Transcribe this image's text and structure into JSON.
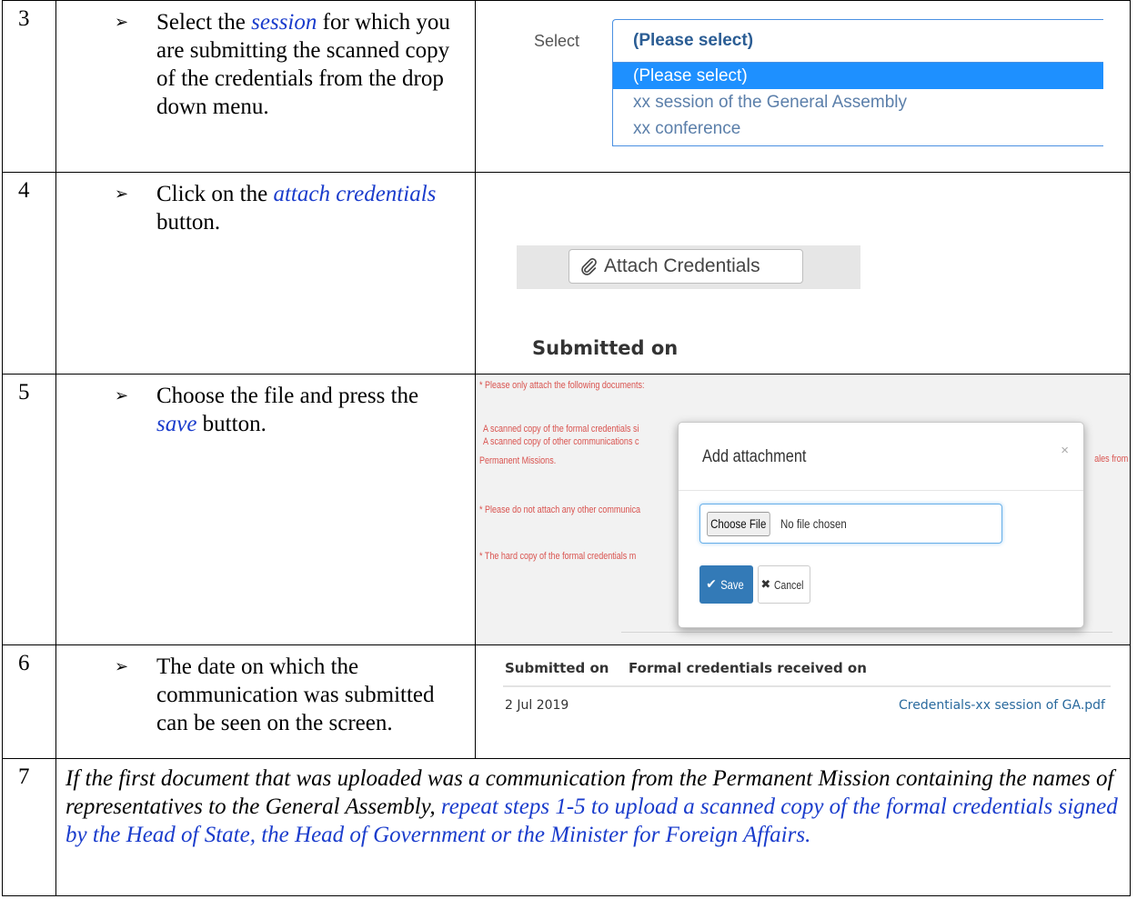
{
  "steps": {
    "step3": {
      "num": "3",
      "text_a": "Select the ",
      "text_em": "session",
      "text_b": " for which you are submitting the scanned copy of the credentials from the drop down menu.",
      "shot": {
        "select_label": "Select",
        "select_value": "(Please select)",
        "options": [
          "(Please select)",
          "xx session of the General Assembly",
          "xx conference"
        ]
      }
    },
    "step4": {
      "num": "4",
      "text_a": "Click on the ",
      "text_em": "attach credentials",
      "text_b": " button.",
      "shot": {
        "button_label": "Attach Credentials",
        "submitted_heading": "Submitted on"
      }
    },
    "step5": {
      "num": "5",
      "text_a": "Choose the file and press the ",
      "text_em": "save",
      "text_b": " button.",
      "shot": {
        "bg_note_1": "* Please only attach the following documents:",
        "bg_note_2": "A scanned copy of the formal credentials si",
        "bg_note_3": "A scanned copy of other communications c",
        "bg_note_4": "Permanent Missions.",
        "bg_note_5": "* Please do not attach any other communica",
        "bg_note_6": "* The hard copy of the formal credentials m",
        "bg_right_fragment": "ales from",
        "modal_title": "Add attachment",
        "modal_close": "×",
        "choose_file": "Choose File",
        "no_file": "No file chosen",
        "save": "Save",
        "cancel": "Cancel"
      }
    },
    "step6": {
      "num": "6",
      "text": "The date on which the communication was submitted can be seen on the screen.",
      "shot": {
        "col_submitted": "Submitted on",
        "col_received": "Formal credentials received on",
        "date": "2 Jul 2019",
        "file_link": "Credentials-xx session of GA.pdf"
      }
    },
    "step7": {
      "num": "7",
      "text_a": "If the first document that was uploaded was a communication from the Permanent Mission containing the names of representatives to the General Assembly, ",
      "text_em": "repeat steps 1-5 to upload a scanned copy of the formal credentials signed by the Head of State, the Head of Government or the Minister for Foreign Affairs."
    }
  },
  "icons": {
    "bullet": "arrow-bullet-icon",
    "attach": "paperclip-icon",
    "save": "checkmark-icon",
    "cancel": "x-icon"
  },
  "colors": {
    "emphasis": "#1a3ccc",
    "select_highlight": "#1e90ff",
    "save_button": "#337ab7",
    "note_red": "#d9534f"
  }
}
